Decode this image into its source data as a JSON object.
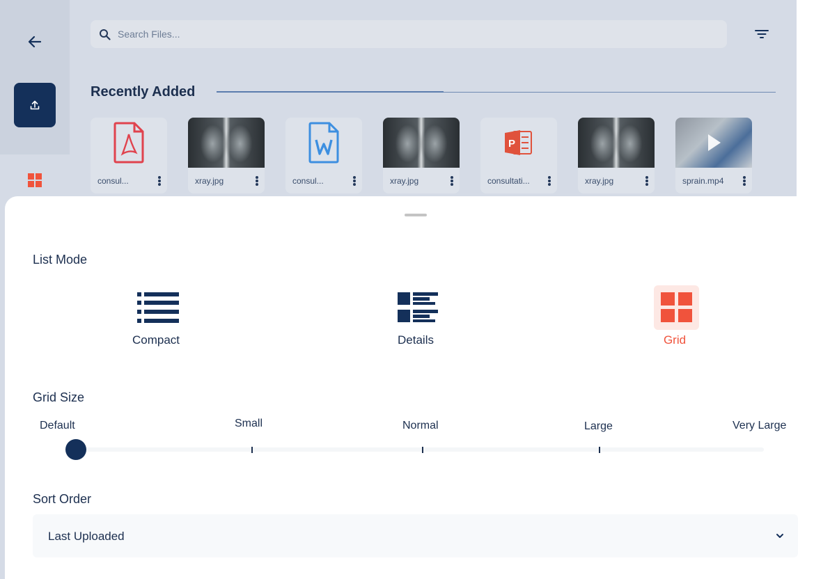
{
  "search": {
    "placeholder": "Search Files..."
  },
  "recent": {
    "title": "Recently Added",
    "files": [
      {
        "name": "consul...",
        "type": "pdf"
      },
      {
        "name": "xray.jpg",
        "type": "image"
      },
      {
        "name": "consul...",
        "type": "word"
      },
      {
        "name": "xray.jpg",
        "type": "image"
      },
      {
        "name": "consultati...",
        "type": "powerpoint"
      },
      {
        "name": "xray.jpg",
        "type": "image"
      },
      {
        "name": "sprain.mp4",
        "type": "video"
      }
    ]
  },
  "sheet": {
    "list_mode_title": "List Mode",
    "modes": [
      {
        "label": "Compact",
        "icon": "compact-list-icon",
        "active": false
      },
      {
        "label": "Details",
        "icon": "details-list-icon",
        "active": false
      },
      {
        "label": "Grid",
        "icon": "grid-icon",
        "active": true
      }
    ],
    "grid_size_title": "Grid Size",
    "grid_sizes": [
      "Default",
      "Small",
      "Normal",
      "Large",
      "Very Large"
    ],
    "grid_size_selected": "Default",
    "sort_order_title": "Sort Order",
    "sort_order_value": "Last Uploaded"
  },
  "colors": {
    "navy": "#14305a",
    "accent": "#f0533c",
    "pdf_red": "#e0434e",
    "word_blue": "#3d8fe0",
    "ppt_red": "#e0523c"
  }
}
